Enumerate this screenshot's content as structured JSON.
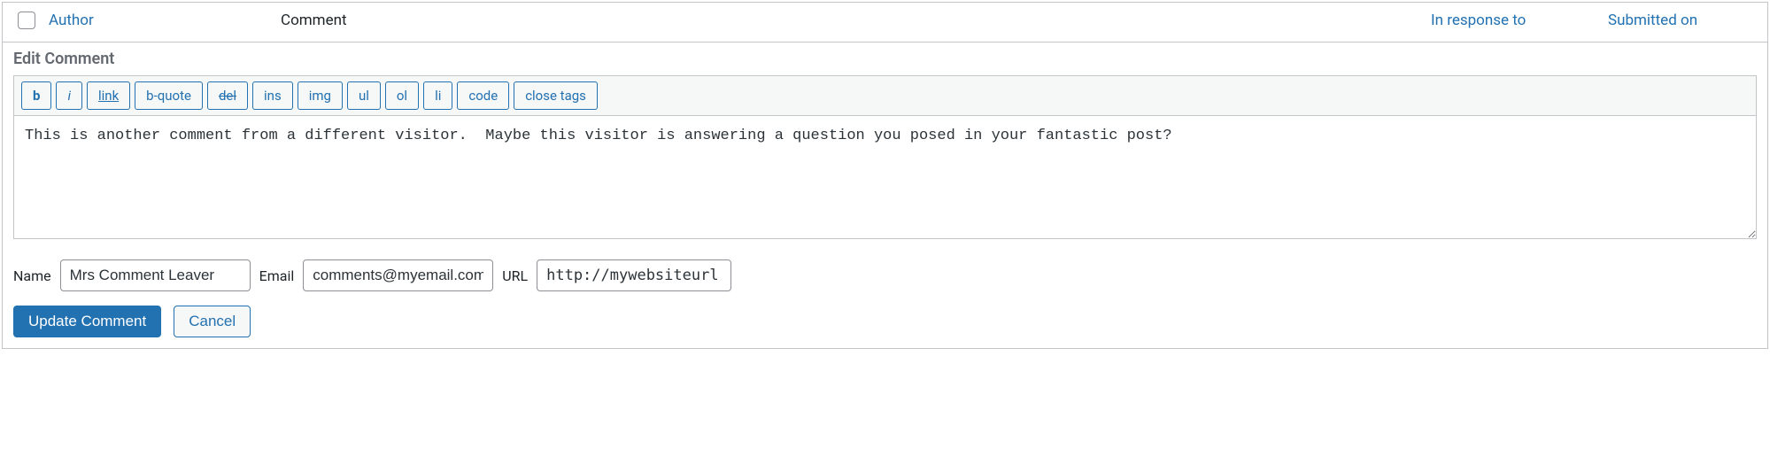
{
  "columns": {
    "author": "Author",
    "comment": "Comment",
    "response": "In response to",
    "submitted": "Submitted on"
  },
  "edit": {
    "heading": "Edit Comment"
  },
  "quicktags": {
    "bold": "b",
    "italic": "i",
    "link": "link",
    "blockquote": "b-quote",
    "del": "del",
    "ins": "ins",
    "img": "img",
    "ul": "ul",
    "ol": "ol",
    "li": "li",
    "code": "code",
    "close": "close tags"
  },
  "comment_text": "This is another comment from a different visitor.  Maybe this visitor is answering a question you posed in your fantastic post?",
  "fields": {
    "name_label": "Name",
    "name_value": "Mrs Comment Leaver",
    "email_label": "Email",
    "email_value": "comments@myemail.com",
    "url_label": "URL",
    "url_value": "http://mywebsiteurl"
  },
  "actions": {
    "update": "Update Comment",
    "cancel": "Cancel"
  }
}
